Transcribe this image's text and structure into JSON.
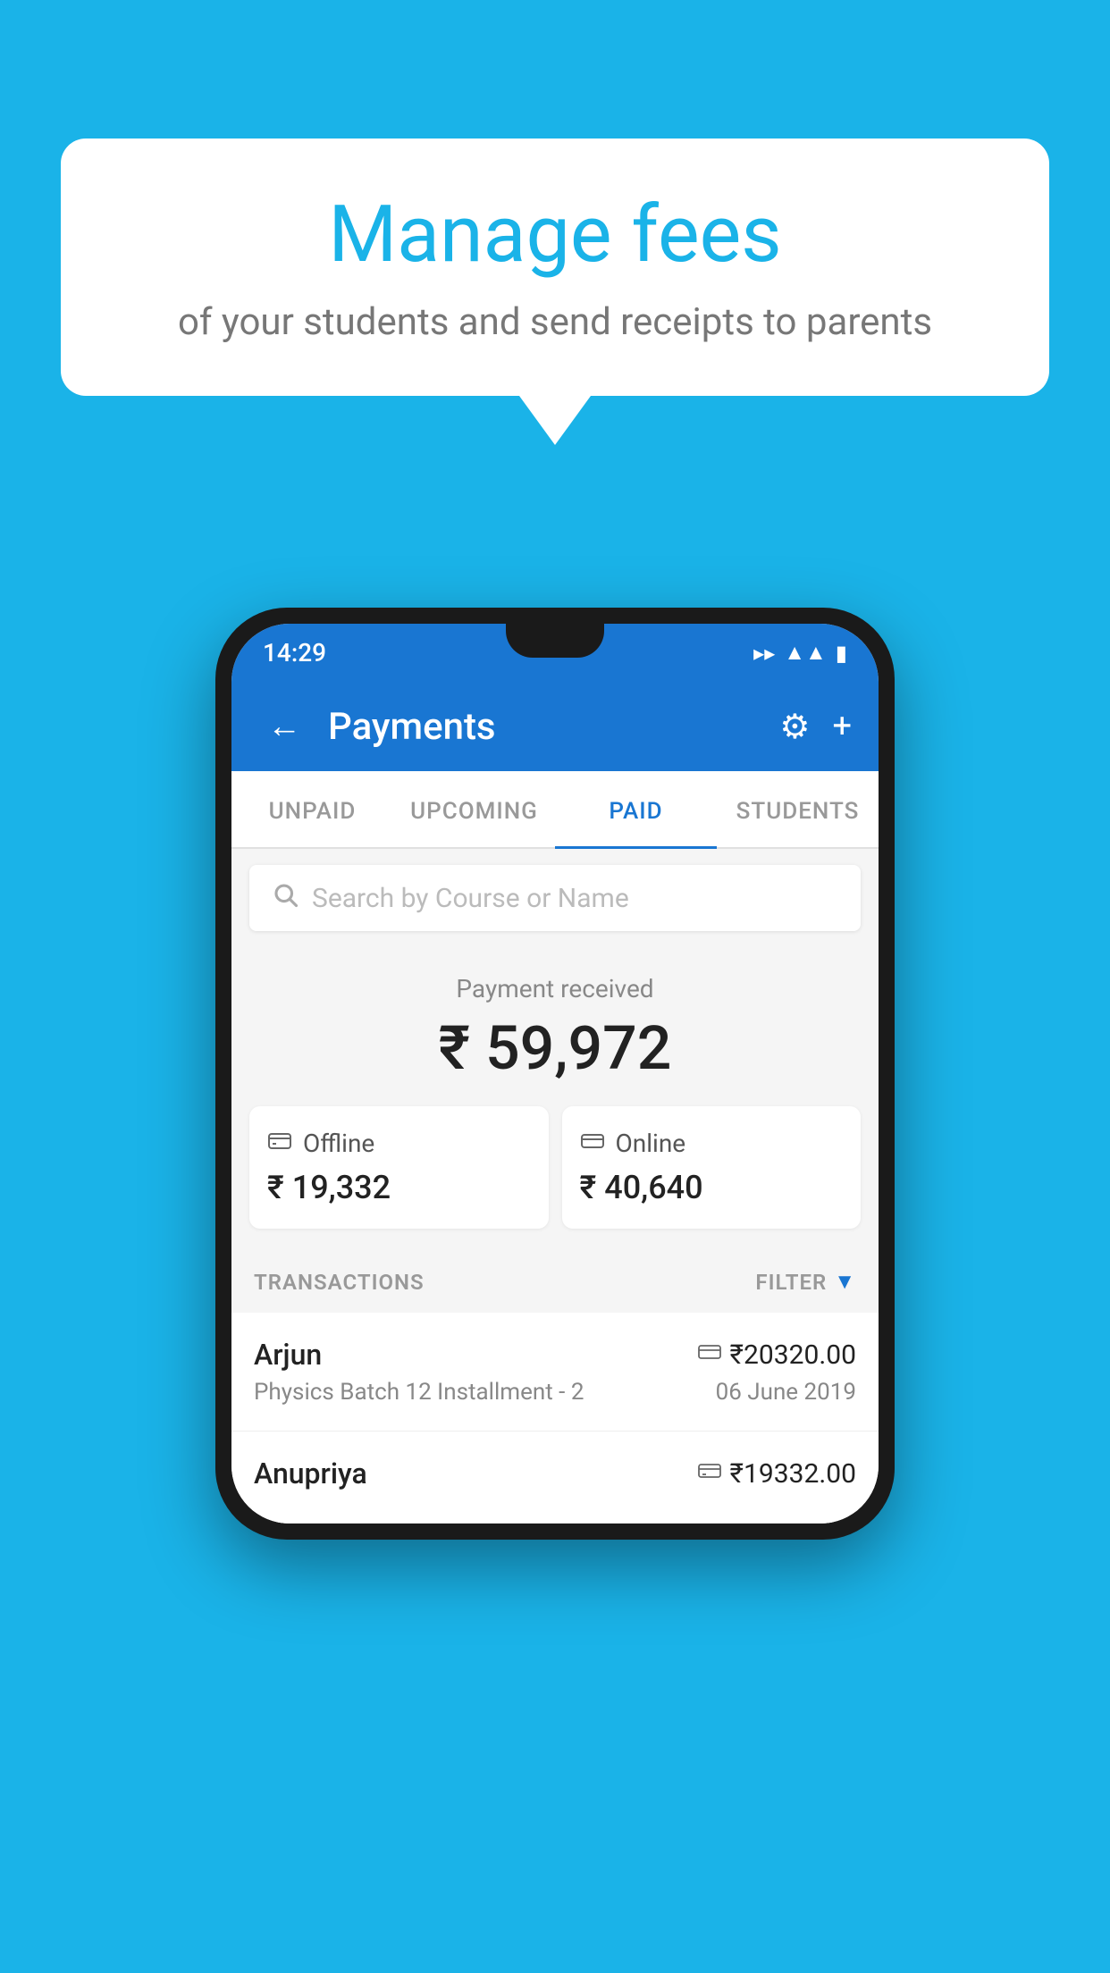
{
  "background_color": "#1ab3e8",
  "speech_bubble": {
    "title": "Manage fees",
    "subtitle": "of your students and send receipts to parents"
  },
  "status_bar": {
    "time": "14:29",
    "wifi": "▾",
    "signal": "▲",
    "battery": "▮"
  },
  "app_bar": {
    "title": "Payments",
    "back_icon": "←",
    "gear_icon": "⚙",
    "plus_icon": "+"
  },
  "tabs": [
    {
      "label": "UNPAID",
      "active": false
    },
    {
      "label": "UPCOMING",
      "active": false
    },
    {
      "label": "PAID",
      "active": true
    },
    {
      "label": "STUDENTS",
      "active": false
    }
  ],
  "search": {
    "placeholder": "Search by Course or Name"
  },
  "payment_summary": {
    "received_label": "Payment received",
    "total_amount": "₹ 59,972",
    "offline": {
      "type": "Offline",
      "amount": "₹ 19,332"
    },
    "online": {
      "type": "Online",
      "amount": "₹ 40,640"
    }
  },
  "transactions": {
    "header_label": "TRANSACTIONS",
    "filter_label": "FILTER",
    "items": [
      {
        "name": "Arjun",
        "amount": "₹20320.00",
        "course": "Physics Batch 12 Installment - 2",
        "date": "06 June 2019",
        "payment_type": "online"
      },
      {
        "name": "Anupriya",
        "amount": "₹19332.00",
        "course": "",
        "date": "",
        "payment_type": "offline"
      }
    ]
  }
}
